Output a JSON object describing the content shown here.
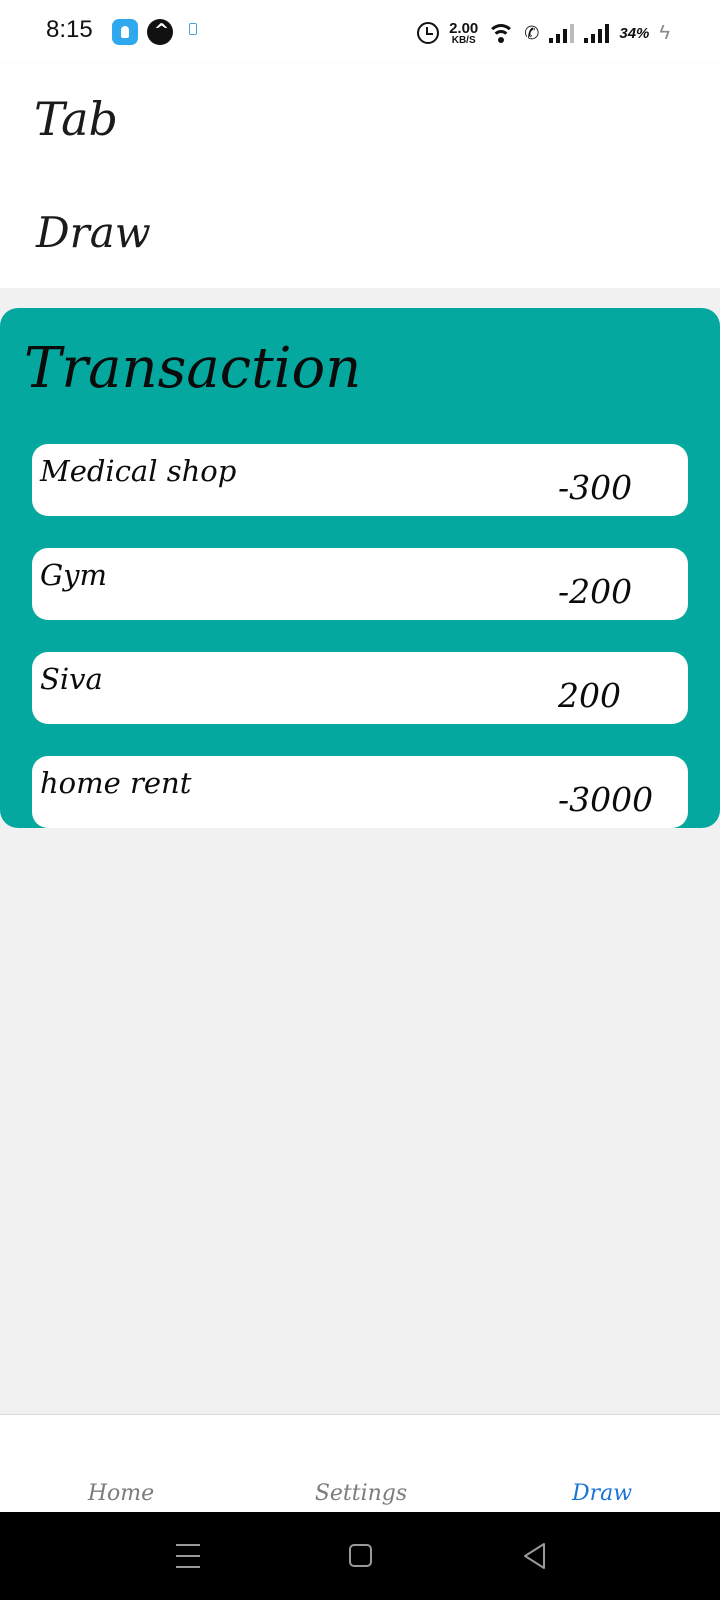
{
  "status_bar": {
    "time": "8:15",
    "net_speed_value": "2.00",
    "net_speed_unit": "KB/S",
    "battery": "34%",
    "icons": [
      "touch-app-icon",
      "nav-app-icon",
      "small-app-icon",
      "alarm-icon",
      "wifi-icon",
      "wifi-calling-icon",
      "signal-icon",
      "signal-icon",
      "charging-icon"
    ]
  },
  "header": {
    "title": "Tab"
  },
  "subheader": {
    "title": "Draw"
  },
  "transactions": {
    "title": "Transaction",
    "items": [
      {
        "name": "Medical shop",
        "amount": "-300"
      },
      {
        "name": "Gym",
        "amount": "-200"
      },
      {
        "name": "Siva",
        "amount": "200"
      },
      {
        "name": "home rent",
        "amount": "-3000"
      }
    ]
  },
  "tabs": [
    {
      "label": "Home",
      "active": false
    },
    {
      "label": "Settings",
      "active": false
    },
    {
      "label": "Draw",
      "active": true
    }
  ],
  "colors": {
    "card": "#04a89e",
    "active_tab": "#1a74d6",
    "inactive_tab": "#7c7c7c",
    "background": "#f1f1f1"
  },
  "navbar": {
    "icons": [
      "menu-icon",
      "home-square-icon",
      "back-triangle-icon"
    ]
  }
}
